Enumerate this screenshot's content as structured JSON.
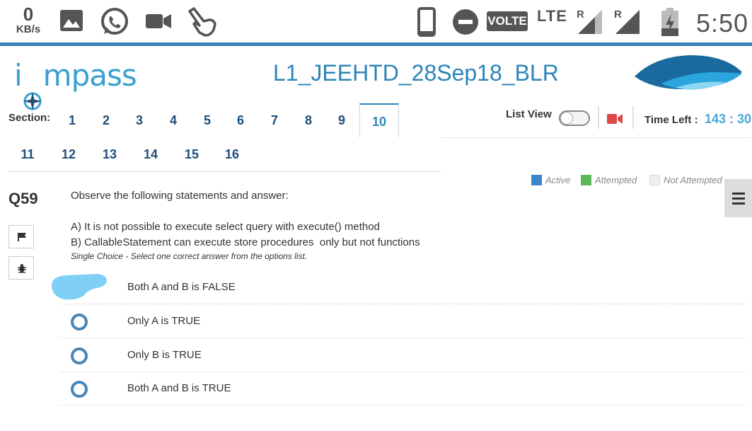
{
  "status_bar": {
    "net_speed_value": "0",
    "net_speed_unit": "KB/s",
    "volte": "VOLTE",
    "network": "LTE",
    "roaming_1": "R",
    "roaming_2": "R",
    "time": "5:50",
    "icons": [
      "gallery-icon",
      "whatsapp-icon",
      "video-camera-icon",
      "pointing-hand-icon",
      "phone-icon",
      "do-not-disturb-icon",
      "signal-icon",
      "battery-charging-icon"
    ]
  },
  "header": {
    "logo_text_left": "i",
    "logo_text_right": "mpass",
    "exam_title": "L1_JEEHTD_28Sep18_BLR"
  },
  "sections": {
    "label": "Section:",
    "items": [
      "1",
      "2",
      "3",
      "4",
      "5",
      "6",
      "7",
      "8",
      "9",
      "10",
      "11",
      "12",
      "13",
      "14",
      "15",
      "16"
    ],
    "active": "10"
  },
  "controls": {
    "list_view_label": "List View",
    "list_view_on": false,
    "time_left_label": "Time Left :",
    "time_left_value": "143 : 30"
  },
  "legend": {
    "active": "Active",
    "attempted": "Attempted",
    "not_attempted": "Not Attempted",
    "colors": {
      "active": "#3b86cf",
      "attempted": "#5cb85c",
      "not_attempted": "#eeeeee"
    }
  },
  "question": {
    "number": "Q59",
    "prompt": "Observe the following statements and answer:",
    "statement_a": "A) It is not possible to execute select query with execute() method",
    "statement_b": "B) CallableStatement can execute store procedures  only but not functions",
    "instruction": "Single Choice - Select one correct answer from the options list.",
    "options": [
      "Both A and B is FALSE",
      "Only A is TRUE",
      "Only B is TRUE",
      "Both A and B is TRUE"
    ]
  },
  "colors": {
    "accent": "#2c85b8",
    "time": "#4aa8d8",
    "radio": "#4a85b8",
    "redaction": "#80cff7",
    "camera": "#e04848"
  }
}
